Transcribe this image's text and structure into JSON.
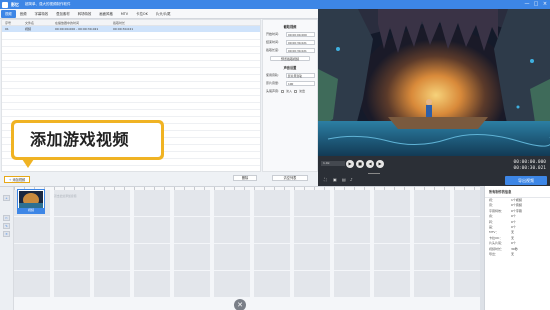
{
  "titlebar": {
    "app_name": "影忆",
    "subtitle": "超简单、强大的视频制作软件",
    "buttons": [
      "—",
      "□",
      "×"
    ]
  },
  "tabs": [
    "视频",
    "音频",
    "字幕特效",
    "叠加素材",
    "转场特效",
    "画面风格",
    "MTV",
    "卡拉OK",
    "片头/片尾"
  ],
  "file_list": {
    "headers": [
      "序号",
      "文件名",
      "在播放器中的时间",
      "截取时长"
    ],
    "rows": [
      {
        "index": "01",
        "name": "视频",
        "time": "00:00:00.000 - 00:00:30.021",
        "length": "00:00:30.021"
      }
    ]
  },
  "side_panel": {
    "title": "截取视频",
    "fields": [
      {
        "label": "开始时间:",
        "value": "00:00:00.000"
      },
      {
        "label": "结束时间:",
        "value": "00:00:30.021"
      },
      {
        "label": "截取长度:",
        "value": "00:00:30.021"
      }
    ],
    "preview_btn": "预览截取视频",
    "sound_title": "声音设置",
    "sound_fields": [
      {
        "label": "使用音轨:",
        "value": "影片原音轨"
      },
      {
        "label": "原片音量:",
        "value": "100"
      }
    ],
    "fade_label": "头尾声音:",
    "fade_in": "淡入",
    "fade_out": "淡出"
  },
  "toolbar": {
    "add_video": "添加视频",
    "delete": "删除",
    "clear": "清空列表"
  },
  "callout": {
    "text": "添加游戏视频"
  },
  "player": {
    "speed": "1.0x",
    "current_time": "00:00:00.000",
    "total_time": "00:00:30.021",
    "export_label": "导出视频"
  },
  "timeline": {
    "clip_label": "视频",
    "placeholder": "双击此处添加音频"
  },
  "info_panel": {
    "title": "所有制作的信息",
    "rows": [
      {
        "k": "视：",
        "v": "1个视频"
      },
      {
        "k": "音：",
        "v": "0个音频"
      },
      {
        "k": "字幕特效：",
        "v": "0个字幕"
      },
      {
        "k": "叠：",
        "v": "0个"
      },
      {
        "k": "转：",
        "v": "0个"
      },
      {
        "k": "画：",
        "v": "0个"
      },
      {
        "k": "MTV：",
        "v": "无"
      },
      {
        "k": "卡拉OK：",
        "v": "无"
      },
      {
        "k": "片头片尾：",
        "v": "0个"
      },
      {
        "k": "视频时长：",
        "v": "30秒"
      },
      {
        "k": "导出：",
        "v": "无"
      }
    ]
  },
  "colors": {
    "accent": "#3d86e6",
    "callout": "#f0b323"
  }
}
